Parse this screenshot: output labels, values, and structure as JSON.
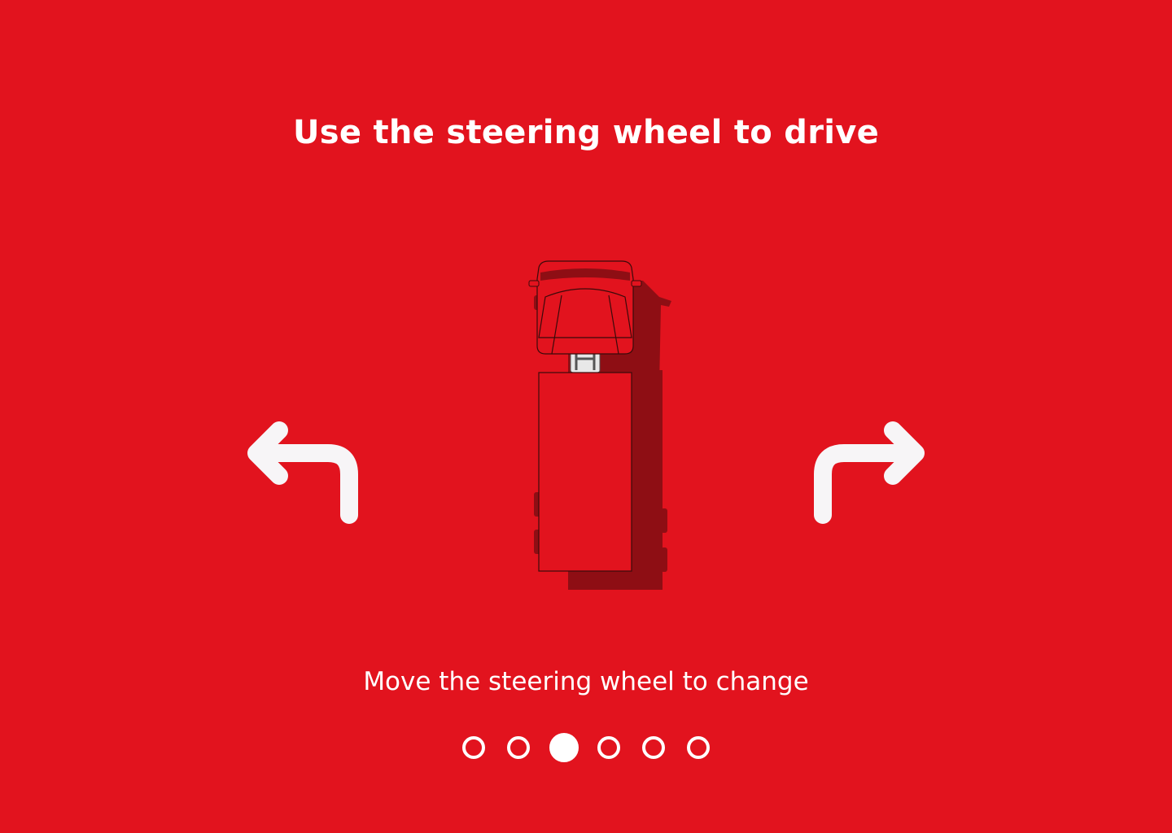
{
  "header": {
    "title": "Use the steering wheel to drive"
  },
  "instructions": {
    "hint": "Move the steering wheel to change"
  },
  "pagination": {
    "total": 6,
    "active_index": 2
  },
  "colors": {
    "background": "#e2131e",
    "foreground": "#ffffff",
    "truck_body": "#e2131e",
    "truck_shadow": "#8e0e14",
    "arrow": "#f7f5f7"
  },
  "icons": {
    "left": "turn-left-arrow-icon",
    "right": "turn-right-arrow-icon",
    "vehicle": "truck-top-view-icon"
  }
}
